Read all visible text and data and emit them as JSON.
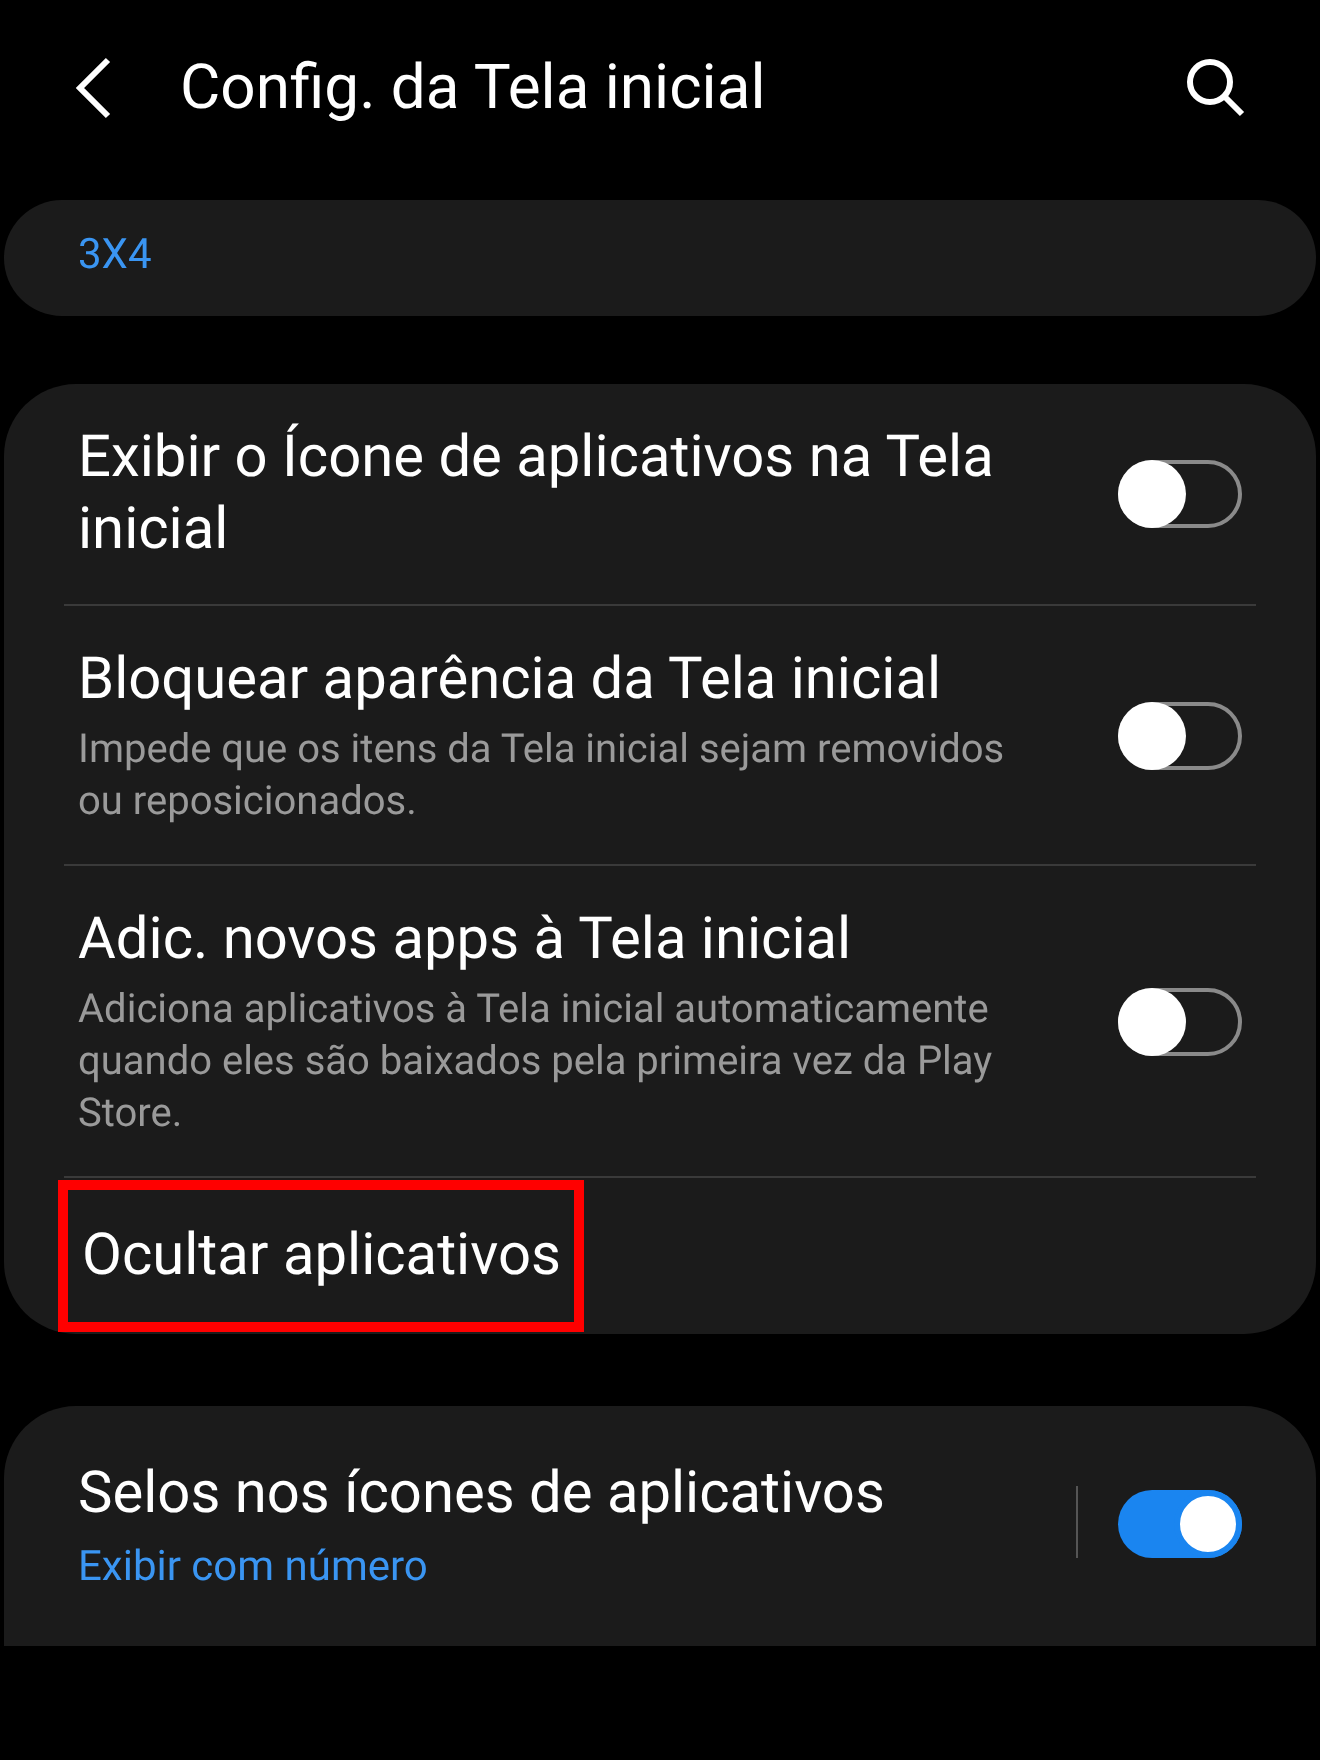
{
  "header": {
    "title": "Config. da Tela inicial"
  },
  "grid_card": {
    "value": "3X4"
  },
  "settings": [
    {
      "kind": "toggle",
      "title": "Exibir o Ícone de aplicativos na Tela inicial",
      "on": false
    },
    {
      "kind": "toggle",
      "title": "Bloquear aparência da Tela inicial",
      "subtitle": "Impede que os itens da Tela inicial sejam removidos ou reposicionados.",
      "on": false
    },
    {
      "kind": "toggle",
      "title": "Adic. novos apps à Tela inicial",
      "subtitle": "Adiciona aplicativos à Tela inicial automaticamente quando eles são baixados pela primeira vez da Play Store.",
      "on": false
    },
    {
      "kind": "link",
      "title": "Ocultar aplicativos",
      "highlighted": true
    }
  ],
  "badges": {
    "title": "Selos nos ícones de aplicativos",
    "value": "Exibir com número",
    "on": true
  }
}
